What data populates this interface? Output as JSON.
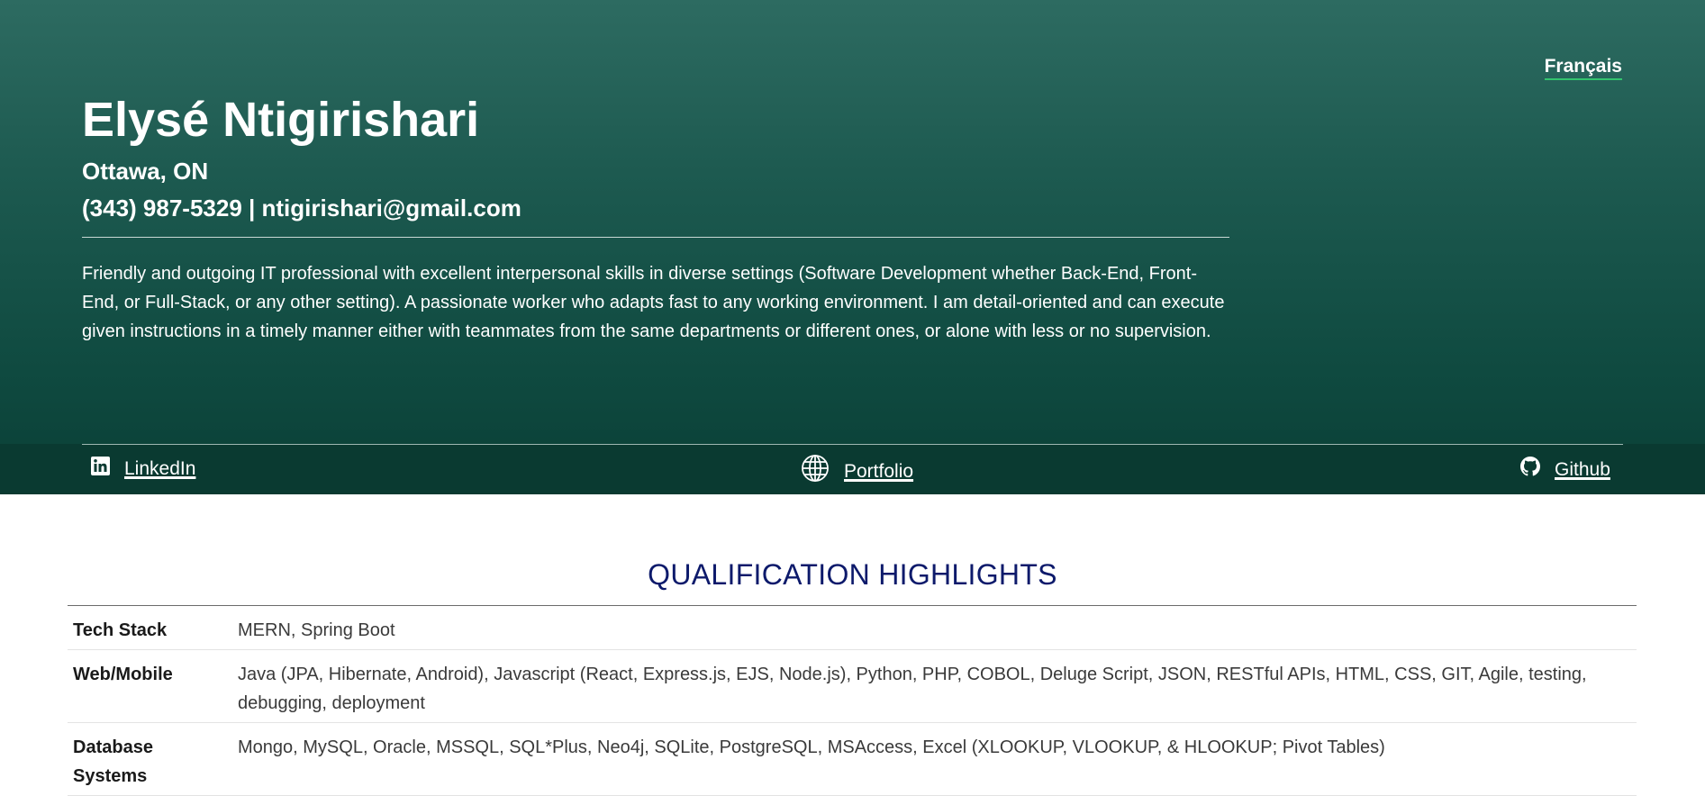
{
  "header": {
    "language_link": "Français",
    "name": "Elysé Ntigirishari",
    "location": "Ottawa, ON",
    "contact": "(343) 987-5329 | ntigirishari@gmail.com",
    "summary": "Friendly and outgoing IT professional with excellent interpersonal skills in diverse settings (Software Development whether Back-End, Front-End, or Full-Stack, or any other setting). A passionate worker who adapts fast to any working environment. I am detail-oriented and can execute given instructions in a timely manner either with teammates from the same departments or different ones, or alone with less or no supervision."
  },
  "links": {
    "linkedin": {
      "label": "LinkedIn",
      "icon": "linkedin-icon"
    },
    "portfolio": {
      "label": "Portfolio",
      "icon": "globe-icon"
    },
    "github": {
      "label": "Github",
      "icon": "github-icon"
    }
  },
  "qualifications": {
    "title": "QUALIFICATION HIGHLIGHTS",
    "rows": [
      {
        "label": "Tech Stack",
        "value": "MERN, Spring Boot"
      },
      {
        "label": "Web/Mobile",
        "value": "Java (JPA, Hibernate, Android), Javascript (React, Express.js, EJS, Node.js), Python, PHP, COBOL, Deluge Script, JSON, RESTful APIs, HTML, CSS, GIT, Agile, testing, debugging, deployment"
      },
      {
        "label": "Database Systems",
        "value": "Mongo, MySQL, Oracle, MSSQL, SQL*Plus, Neo4j, SQLite, PostgreSQL, MSAccess, Excel (XLOOKUP, VLOOKUP, & HLOOKUP; Pivot Tables)"
      }
    ]
  },
  "colors": {
    "hero_top": "#2d6b61",
    "hero_bottom": "#0a3f36",
    "links_bar": "#0a3a31",
    "heading_blue": "#0d1a6b",
    "underline_green": "#33c46e"
  }
}
